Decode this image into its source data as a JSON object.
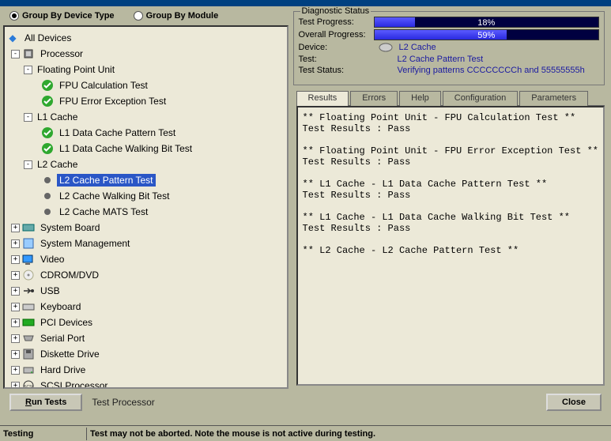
{
  "groupby": {
    "device": "Group By Device Type",
    "module": "Group By Module",
    "selected": "device"
  },
  "tree": {
    "root": "All Devices",
    "processor": "Processor",
    "fpu": {
      "label": "Floating Point Unit",
      "t1": "FPU Calculation Test",
      "t2": "FPU Error Exception Test"
    },
    "l1": {
      "label": "L1 Cache",
      "t1": "L1 Data Cache Pattern Test",
      "t2": "L1 Data Cache Walking Bit Test"
    },
    "l2": {
      "label": "L2 Cache",
      "t1": "L2 Cache Pattern Test",
      "t2": "L2 Cache Walking Bit Test",
      "t3": "L2 Cache MATS Test"
    },
    "sysboard": "System Board",
    "sysmgmt": "System Management",
    "video": "Video",
    "cdrom": "CDROM/DVD",
    "usb": "USB",
    "keyboard": "Keyboard",
    "pci": "PCI Devices",
    "serial": "Serial Port",
    "diskette": "Diskette Drive",
    "hdd": "Hard Drive",
    "scsi": "SCSI Processor"
  },
  "diag": {
    "legend": "Diagnostic Status",
    "testprog_label": "Test Progress:",
    "testprog_pct": 18,
    "testprog_txt": "18%",
    "overall_label": "Overall Progress:",
    "overall_pct": 59,
    "overall_txt": "59%",
    "device_label": "Device:",
    "device_val": "L2 Cache",
    "test_label": "Test:",
    "test_val": "L2 Cache Pattern Test",
    "status_label": "Test Status:",
    "status_val": "Verifying patterns CCCCCCCCh and 55555555h"
  },
  "tabs": {
    "results": "Results",
    "errors": "Errors",
    "help": "Help",
    "config": "Configuration",
    "params": "Parameters",
    "active": "results"
  },
  "results_text": "** Floating Point Unit - FPU Calculation Test **\nTest Results : Pass\n\n** Floating Point Unit - FPU Error Exception Test **\nTest Results : Pass\n\n** L1 Cache - L1 Data Cache Pattern Test **\nTest Results : Pass\n\n** L1 Cache - L1 Data Cache Walking Bit Test **\nTest Results : Pass\n\n** L2 Cache - L2 Cache Pattern Test **",
  "buttons": {
    "run": "Run Tests",
    "close": "Close",
    "proc": "Test Processor"
  },
  "statusbar": {
    "left": "Testing",
    "right": "Test may not be aborted.  Note the mouse is not active during testing."
  }
}
